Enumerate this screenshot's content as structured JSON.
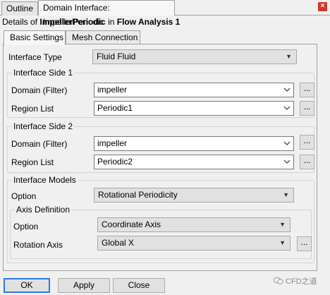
{
  "top_tabs": [
    {
      "label": "Outline"
    },
    {
      "label": "Domain Interface: ImpellerPeriodic"
    }
  ],
  "details": {
    "prefix": "Details of ",
    "object": "ImpellerPeriodic",
    "middle": " in ",
    "container": "Flow Analysis 1"
  },
  "inner_tabs": [
    {
      "label": "Basic Settings"
    },
    {
      "label": "Mesh Connection"
    }
  ],
  "interface_type": {
    "label": "Interface Type",
    "value": "Fluid Fluid"
  },
  "side1": {
    "title": "Interface Side 1",
    "domain_label": "Domain (Filter)",
    "domain_value": "impeller",
    "region_label": "Region List",
    "region_value": "Periodic1"
  },
  "side2": {
    "title": "Interface Side 2",
    "domain_label": "Domain (Filter)",
    "domain_value": "impeller",
    "region_label": "Region List",
    "region_value": "Periodic2"
  },
  "models": {
    "title": "Interface Models",
    "option_label": "Option",
    "option_value": "Rotational Periodicity",
    "axis_title": "Axis Definition",
    "axis_option_label": "Option",
    "axis_option_value": "Coordinate Axis",
    "rotation_axis_label": "Rotation Axis",
    "rotation_axis_value": "Global X"
  },
  "browse_label": "...",
  "buttons": {
    "ok": "OK",
    "apply": "Apply",
    "close": "Close"
  },
  "watermark": "CFD之道",
  "colors": {
    "close_tab": "#cc3a2a",
    "default_button_border": "#2f7bd6",
    "background": "#f0f0f0"
  }
}
